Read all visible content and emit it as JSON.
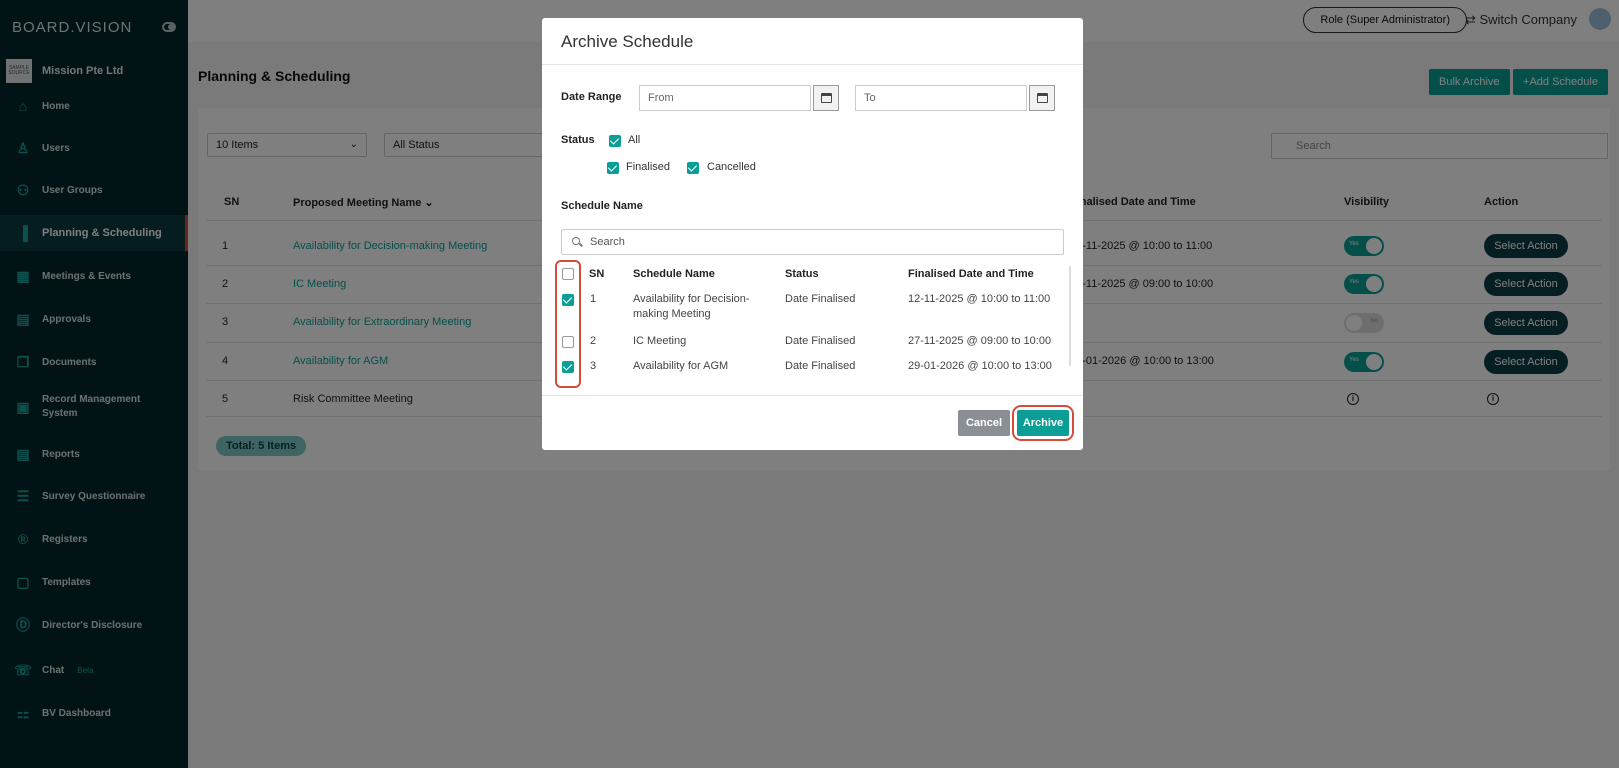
{
  "brand": {
    "name": "BOARD.VISION"
  },
  "company": {
    "name": "Mission Pte Ltd",
    "logo_text": "SAMPLE SOURCE"
  },
  "sidebar": {
    "items": [
      {
        "label": "Home",
        "icon": "home-icon"
      },
      {
        "label": "Users",
        "icon": "user-icon"
      },
      {
        "label": "User Groups",
        "icon": "users-icon"
      },
      {
        "label": "Planning & Scheduling",
        "icon": "bar-chart-icon",
        "active": true
      },
      {
        "label": "Meetings & Events",
        "icon": "calendar-icon"
      },
      {
        "label": "Approvals",
        "icon": "document-check-icon"
      },
      {
        "label": "Documents",
        "icon": "documents-icon"
      },
      {
        "label": "Record Management System",
        "icon": "records-icon"
      },
      {
        "label": "Reports",
        "icon": "report-icon"
      },
      {
        "label": "Survey Questionnaire",
        "icon": "survey-icon"
      },
      {
        "label": "Registers",
        "icon": "registered-icon"
      },
      {
        "label": "Templates",
        "icon": "template-icon"
      },
      {
        "label": "Director's Disclosure",
        "icon": "disclosure-icon"
      },
      {
        "label": "Chat",
        "icon": "chat-icon",
        "badge": "Beta"
      },
      {
        "label": "BV Dashboard",
        "icon": "dashboard-icon"
      }
    ]
  },
  "topbar": {
    "role": "Role (Super Administrator)",
    "switch_company": "Switch Company"
  },
  "main": {
    "title": "Planning & Scheduling",
    "bulk_archive": "Bulk Archive",
    "add_schedule": "Add Schedule",
    "page_size": "10 Items",
    "status_filter": "All Status",
    "search_placeholder": "Search",
    "columns": {
      "sn": "SN",
      "name": "Proposed Meeting Name",
      "finalised": "Finalised Date and Time",
      "visibility": "Visibility",
      "action": "Action"
    },
    "rows": [
      {
        "sn": "1",
        "name": "Availability for Decision-making Meeting",
        "finalised": "12-11-2025 @ 10:00 to 11:00",
        "visible": "Yes",
        "action": "Select Action"
      },
      {
        "sn": "2",
        "name": "IC Meeting",
        "finalised": "27-11-2025 @ 09:00 to 10:00",
        "visible": "Yes",
        "action": "Select Action"
      },
      {
        "sn": "3",
        "name": "Availability for Extraordinary Meeting",
        "finalised": "",
        "visible": "No",
        "action": "Select Action"
      },
      {
        "sn": "4",
        "name": "Availability for AGM",
        "finalised": "29-01-2026 @ 10:00 to 13:00",
        "visible": "Yes",
        "action": "Select Action"
      },
      {
        "sn": "5",
        "name": "Risk Committee Meeting",
        "finalised": "",
        "visible": "",
        "action": ""
      }
    ],
    "total": "Total: 5 Items"
  },
  "modal": {
    "title": "Archive Schedule",
    "date_range_label": "Date Range",
    "from_placeholder": "From",
    "to_placeholder": "To",
    "status_label": "Status",
    "status_all": "All",
    "status_finalised": "Finalised",
    "status_cancelled": "Cancelled",
    "schedule_name_label": "Schedule Name",
    "search_placeholder": "Search",
    "columns": {
      "sn": "SN",
      "name": "Schedule Name",
      "status": "Status",
      "finalised": "Finalised Date and Time"
    },
    "rows": [
      {
        "sn": "1",
        "name": "Availability for Decision-making Meeting",
        "status": "Date Finalised",
        "finalised": "12-11-2025 @ 10:00 to 11:00",
        "checked": true
      },
      {
        "sn": "2",
        "name": "IC Meeting",
        "status": "Date Finalised",
        "finalised": "27-11-2025 @ 09:00 to 10:00",
        "checked": false
      },
      {
        "sn": "3",
        "name": "Availability for AGM",
        "status": "Date Finalised",
        "finalised": "29-01-2026 @ 10:00 to 13:00",
        "checked": true
      }
    ],
    "cancel": "Cancel",
    "archive": "Archive"
  },
  "colors": {
    "teal": "#0b9e97",
    "sidebar_bg": "#03272a",
    "highlight": "#d84a3a",
    "action_btn": "#0b3d44"
  }
}
